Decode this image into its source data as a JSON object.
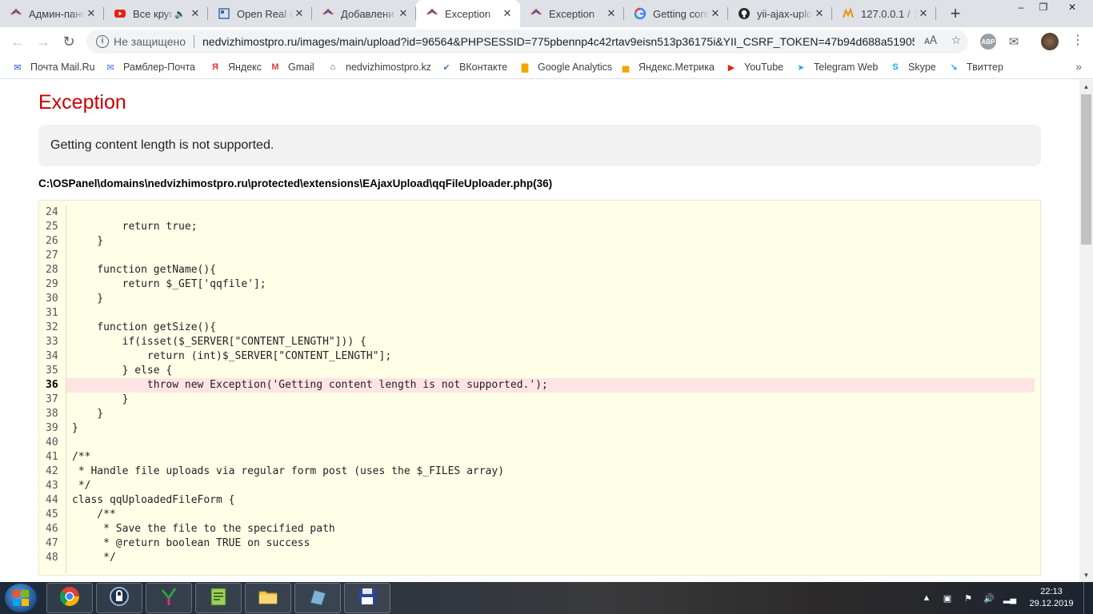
{
  "browser": {
    "tabs": [
      {
        "title": "Админ-пане",
        "favicon": "house-icon",
        "active": false
      },
      {
        "title": "Все круг",
        "favicon": "youtube-icon",
        "active": false,
        "audio": true
      },
      {
        "title": "Open Real E",
        "favicon": "doc-icon",
        "active": false
      },
      {
        "title": "Добавлени",
        "favicon": "house-icon",
        "active": false
      },
      {
        "title": "Exception",
        "favicon": "house-icon",
        "active": true
      },
      {
        "title": "Exception",
        "favicon": "house-icon",
        "active": false
      },
      {
        "title": "Getting cont",
        "favicon": "google-icon",
        "active": false
      },
      {
        "title": "yii-ajax-uplo",
        "favicon": "github-icon",
        "active": false
      },
      {
        "title": "127.0.0.1 / 1",
        "favicon": "phpmyadmin-icon",
        "active": false
      }
    ],
    "new_tab_symbol": "+",
    "security_text": "Не защищено",
    "url": "nedvizhimostpro.ru/images/main/upload?id=96564&PHPSESSID=775pbennp4c42rtav9eisn513p36175i&YII_CSRF_TOKEN=47b94d688a51905c...",
    "extension_abp": "ABP",
    "bookmarks": [
      {
        "label": "Почта Mail.Ru",
        "icon": "mail-envelope-icon",
        "color": "#1a56c9"
      },
      {
        "label": "Рамблер-Почта",
        "icon": "mail-envelope-icon",
        "color": "#3a6fd8"
      },
      {
        "label": "Яндекс",
        "icon": "yandex-icon",
        "color": "#e62e2e"
      },
      {
        "label": "Gmail",
        "icon": "gmail-icon",
        "color": "#d44638"
      },
      {
        "label": "nedvizhimostpro.kz",
        "icon": "house-icon",
        "color": "#1f4e9c"
      },
      {
        "label": "ВКонтакте",
        "icon": "vk-icon",
        "color": "#4a76a8"
      },
      {
        "label": "Google Analytics",
        "icon": "analytics-icon",
        "color": "#f4a400"
      },
      {
        "label": "Яндекс.Метрика",
        "icon": "metrika-icon",
        "color": "#f4a400"
      },
      {
        "label": "YouTube",
        "icon": "youtube-icon",
        "color": "#e62117"
      },
      {
        "label": "Telegram Web",
        "icon": "telegram-icon",
        "color": "#2ca5e0"
      },
      {
        "label": "Skype",
        "icon": "skype-icon",
        "color": "#00aff0"
      },
      {
        "label": "Твиттер",
        "icon": "twitter-icon",
        "color": "#1da1f2"
      }
    ]
  },
  "page": {
    "title": "Exception",
    "message": "Getting content length is not supported.",
    "file": "C:\\OSPanel\\domains\\nedvizhimostpro.ru\\protected\\extensions\\EAjaxUpload\\qqFileUploader.php(36)",
    "highlight_line": "36",
    "code": [
      {
        "n": "24",
        "t": ""
      },
      {
        "n": "25",
        "t": "        return true;"
      },
      {
        "n": "26",
        "t": "    }"
      },
      {
        "n": "27",
        "t": ""
      },
      {
        "n": "28",
        "t": "    function getName(){"
      },
      {
        "n": "29",
        "t": "        return $_GET['qqfile'];"
      },
      {
        "n": "30",
        "t": "    }"
      },
      {
        "n": "31",
        "t": ""
      },
      {
        "n": "32",
        "t": "    function getSize(){"
      },
      {
        "n": "33",
        "t": "        if(isset($_SERVER[\"CONTENT_LENGTH\"])) {"
      },
      {
        "n": "34",
        "t": "            return (int)$_SERVER[\"CONTENT_LENGTH\"];"
      },
      {
        "n": "35",
        "t": "        } else {"
      },
      {
        "n": "36",
        "t": "            throw new Exception('Getting content length is not supported.');"
      },
      {
        "n": "37",
        "t": "        }"
      },
      {
        "n": "38",
        "t": "    }"
      },
      {
        "n": "39",
        "t": "}"
      },
      {
        "n": "40",
        "t": ""
      },
      {
        "n": "41",
        "t": "/**"
      },
      {
        "n": "42",
        "t": " * Handle file uploads via regular form post (uses the $_FILES array)"
      },
      {
        "n": "43",
        "t": " */"
      },
      {
        "n": "44",
        "t": "class qqUploadedFileForm {"
      },
      {
        "n": "45",
        "t": "    /**"
      },
      {
        "n": "46",
        "t": "     * Save the file to the specified path"
      },
      {
        "n": "47",
        "t": "     * @return boolean TRUE on success"
      },
      {
        "n": "48",
        "t": "     */"
      }
    ]
  },
  "taskbar": {
    "apps": [
      "chrome-icon",
      "keepass-icon",
      "yii-icon",
      "notepad-icon",
      "explorer-folder-icon",
      "sandbox-icon",
      "floppy-save-icon"
    ],
    "time": "22:13",
    "date": "29.12.2019"
  },
  "colors": {
    "title_red": "#cc0000",
    "highlight_bg": "#ffe4e4",
    "code_bg": "#ffffe8"
  }
}
